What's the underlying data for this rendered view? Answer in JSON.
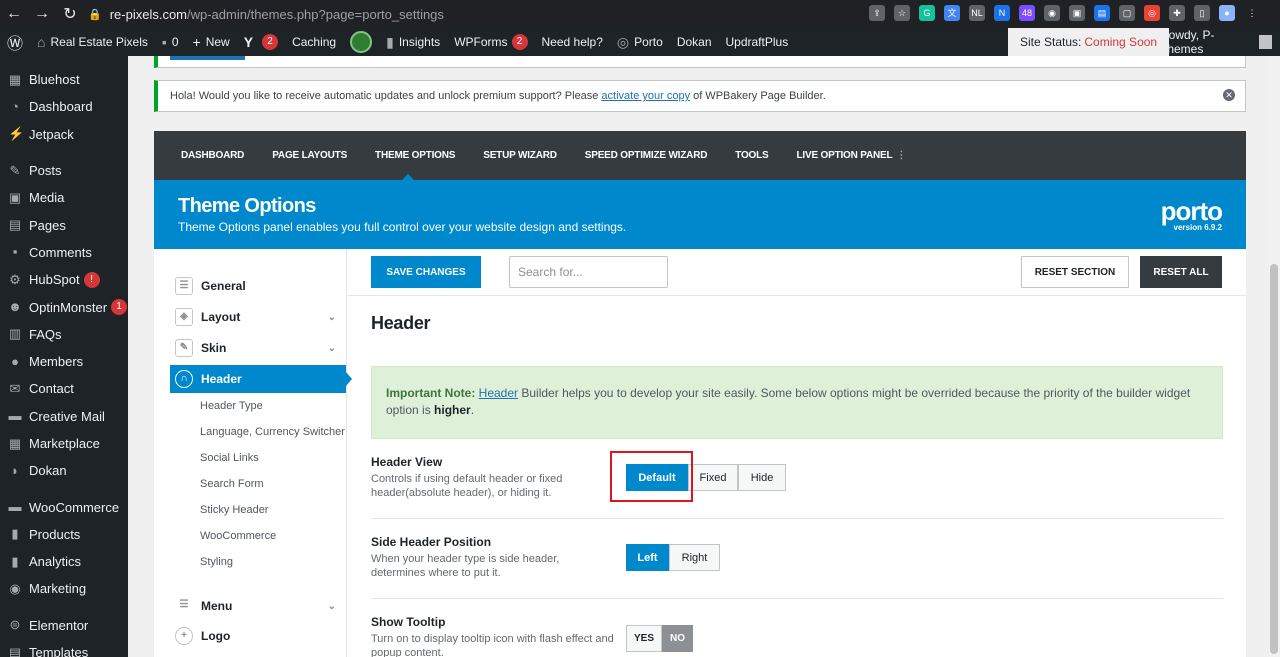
{
  "browser": {
    "url_host": "re-pixels.com",
    "url_path": "/wp-admin/themes.php?page=porto_settings"
  },
  "adminbar": {
    "site_name": "Real Estate Pixels",
    "comments_count": "0",
    "new_label": "New",
    "yoast_badge": "2",
    "caching": "Caching",
    "insights": "Insights",
    "wpforms": "WPForms",
    "wpforms_badge": "2",
    "need_help": "Need help?",
    "porto": "Porto",
    "dokan": "Dokan",
    "updraft": "UpdraftPlus",
    "site_status_label": "Site Status:",
    "site_status_value": "Coming Soon",
    "howdy": "Howdy, P-Themes"
  },
  "sidebar": {
    "items": [
      {
        "label": "Bluehost",
        "icon": "grid-icon"
      },
      {
        "label": "Dashboard",
        "icon": "dashboard-icon"
      },
      {
        "label": "Jetpack",
        "icon": "jetpack-icon"
      },
      {
        "label": "Posts",
        "icon": "pin-icon"
      },
      {
        "label": "Media",
        "icon": "media-icon"
      },
      {
        "label": "Pages",
        "icon": "pages-icon"
      },
      {
        "label": "Comments",
        "icon": "comment-icon"
      },
      {
        "label": "HubSpot",
        "icon": "hubspot-icon",
        "badge": "!"
      },
      {
        "label": "OptinMonster",
        "icon": "optinmonster-icon",
        "badge": "1"
      },
      {
        "label": "FAQs",
        "icon": "faq-icon"
      },
      {
        "label": "Members",
        "icon": "members-icon"
      },
      {
        "label": "Contact",
        "icon": "mail-icon"
      },
      {
        "label": "Creative Mail",
        "icon": "creative-mail-icon"
      },
      {
        "label": "Marketplace",
        "icon": "marketplace-icon"
      },
      {
        "label": "Dokan",
        "icon": "dokan-icon"
      },
      {
        "label": "WooCommerce",
        "icon": "woo-icon"
      },
      {
        "label": "Products",
        "icon": "products-icon"
      },
      {
        "label": "Analytics",
        "icon": "analytics-icon"
      },
      {
        "label": "Marketing",
        "icon": "marketing-icon"
      },
      {
        "label": "Elementor",
        "icon": "elementor-icon"
      },
      {
        "label": "Templates",
        "icon": "templates-icon"
      }
    ]
  },
  "notice": {
    "text_before": "Hola! Would you like to receive automatic updates and unlock premium support? Please",
    "link": "activate your copy",
    "text_after": "of WPBakery Page Builder."
  },
  "porto_nav": {
    "items": [
      "DASHBOARD",
      "PAGE LAYOUTS",
      "THEME OPTIONS",
      "SETUP WIZARD",
      "SPEED OPTIMIZE WIZARD",
      "TOOLS",
      "LIVE OPTION PANEL"
    ],
    "active": "THEME OPTIONS"
  },
  "banner": {
    "title": "Theme Options",
    "subtitle": "Theme Options panel enables you full control over your website design and settings.",
    "logo": "porto",
    "version": "version 6.9.2"
  },
  "options_menu": {
    "general": "General",
    "layout": "Layout",
    "skin": "Skin",
    "header": "Header",
    "sub_items": [
      "Header Type",
      "Language, Currency Switcher",
      "Social Links",
      "Search Form",
      "Sticky Header",
      "WooCommerce",
      "Styling"
    ],
    "menu": "Menu",
    "logo": "Logo"
  },
  "toolbar": {
    "save": "SAVE CHANGES",
    "search_placeholder": "Search for...",
    "reset_section": "RESET SECTION",
    "reset_all": "RESET ALL"
  },
  "main": {
    "section_title": "Header",
    "note_label": "Important Note:",
    "note_link": "Header",
    "note_text": "Builder helps you to develop your site easily. Some below options might be overrided because the priority of the builder widget option is",
    "note_bold": "higher",
    "note_end": "."
  },
  "fields": {
    "header_view": {
      "title": "Header View",
      "desc": "Controls if using default header or fixed header(absolute header), or hiding it.",
      "options": [
        "Default",
        "Fixed",
        "Hide"
      ],
      "selected": "Default"
    },
    "side_header": {
      "title": "Side Header Position",
      "desc": "When your header type is side header, determines where to put it.",
      "options": [
        "Left",
        "Right"
      ],
      "selected": "Left"
    },
    "show_tooltip": {
      "title": "Show Tooltip",
      "desc": "Turn on to display tooltip icon with flash effect and popup content.",
      "yes": "YES",
      "no": "NO",
      "selected": "NO"
    }
  }
}
